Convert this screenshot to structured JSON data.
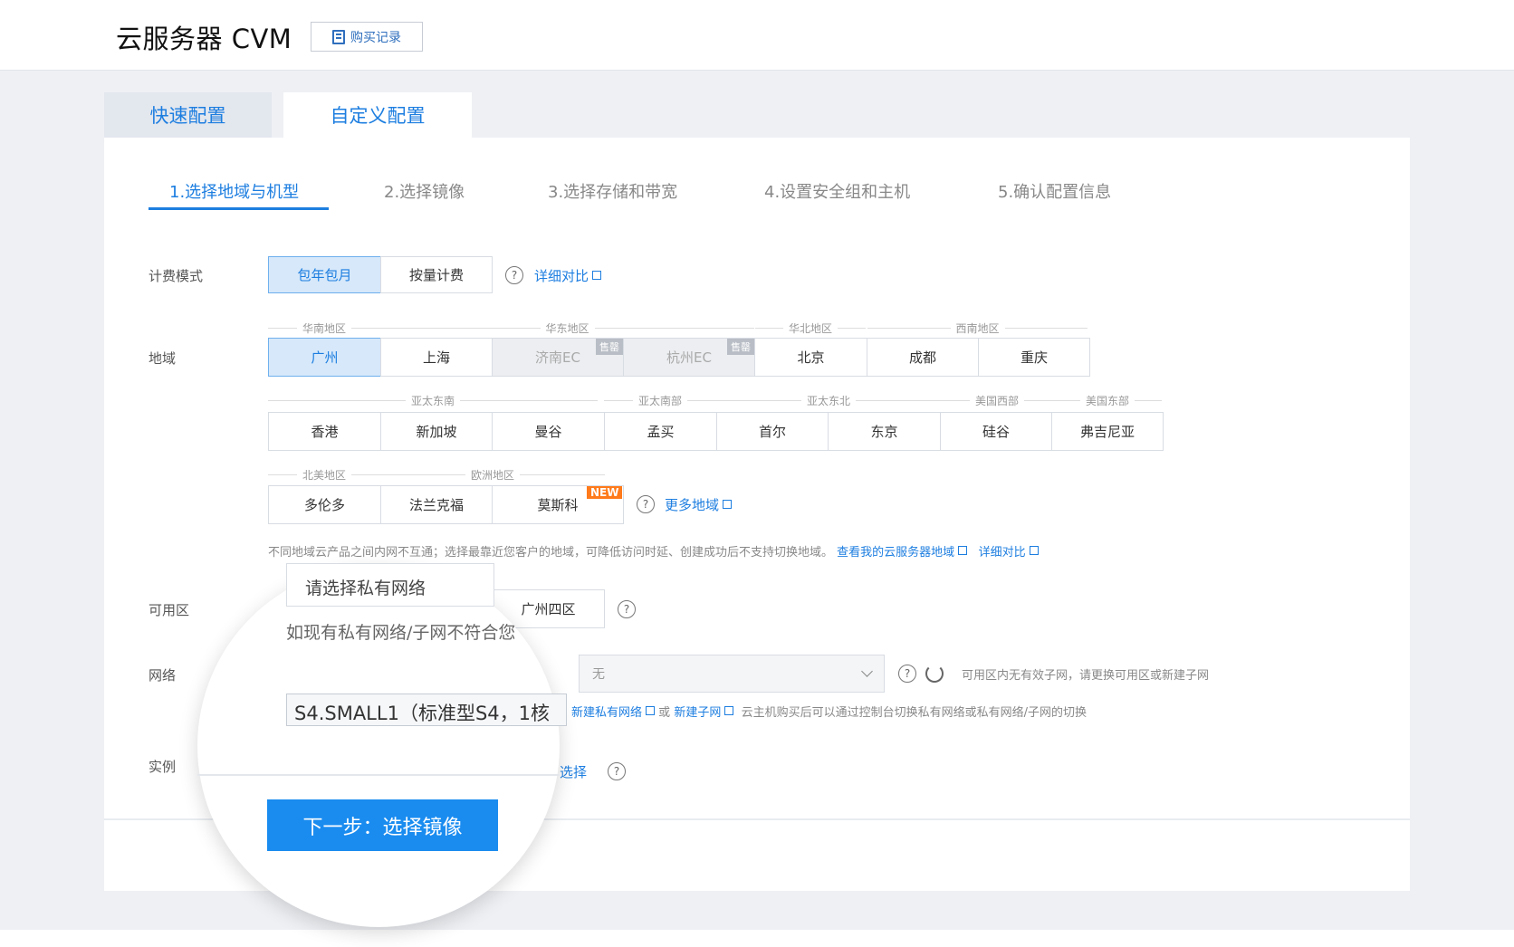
{
  "header": {
    "title": "云服务器 CVM",
    "purchase_record": "购买记录"
  },
  "config_tabs": {
    "quick": "快速配置",
    "custom": "自定义配置"
  },
  "steps": [
    "1.选择地域与机型",
    "2.选择镜像",
    "3.选择存储和带宽",
    "4.设置安全组和主机",
    "5.确认配置信息"
  ],
  "billing": {
    "label": "计费模式",
    "options": [
      "包年包月",
      "按量计费"
    ],
    "compare_link": "详细对比"
  },
  "region": {
    "label": "地域",
    "row1_groups": [
      "华南地区",
      "华东地区",
      "华北地区",
      "西南地区"
    ],
    "row1": [
      {
        "name": "广州",
        "state": "selected"
      },
      {
        "name": "上海",
        "state": "normal"
      },
      {
        "name": "济南EC",
        "state": "disabled",
        "tag": "售罄"
      },
      {
        "name": "杭州EC",
        "state": "disabled",
        "tag": "售罄"
      },
      {
        "name": "北京",
        "state": "normal"
      },
      {
        "name": "成都",
        "state": "normal"
      },
      {
        "name": "重庆",
        "state": "normal"
      }
    ],
    "row2_groups": [
      "亚太东南",
      "亚太南部",
      "亚太东北",
      "美国西部",
      "美国东部"
    ],
    "row2": [
      "香港",
      "新加坡",
      "曼谷",
      "孟买",
      "首尔",
      "东京",
      "硅谷",
      "弗吉尼亚"
    ],
    "row3_groups": [
      "北美地区",
      "欧洲地区"
    ],
    "row3": [
      "多伦多",
      "法兰克福",
      "莫斯科"
    ],
    "new_tag": "NEW",
    "more_link": "更多地域",
    "note": "不同地域云产品之间内网不互通；选择最靠近您客户的地域，可降低访问时延、创建成功后不支持切换地域。",
    "note_link1": "查看我的云服务器地域",
    "note_link2": "详细对比"
  },
  "zone": {
    "label": "可用区",
    "option": "广州四区"
  },
  "network": {
    "label": "网络",
    "placeholder": "请选择私有网络",
    "hint_text": "如现有私有网络/子网不符合您",
    "subnet_value": "无",
    "subnet_note": "可用区内无有效子网，请更换可用区或新建子网",
    "create_vpc": "新建私有网络",
    "and": "或",
    "create_subnet": "新建子网",
    "bottom_note": "云主机购买后可以通过控制台切换私有网络或私有网络/子网的切换"
  },
  "instance": {
    "label": "实例",
    "value": "S4.SMALL1（标准型S4，1核",
    "choose_link": "选择"
  },
  "next_button": "下一步：选择镜像"
}
